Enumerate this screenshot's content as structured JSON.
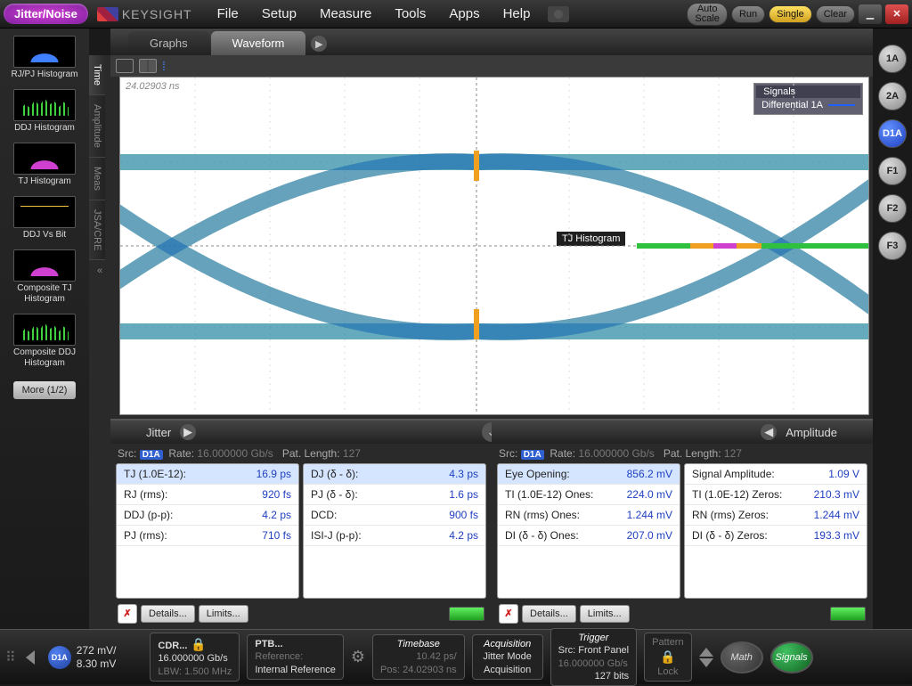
{
  "menubar": {
    "badge": "Jitter/Noise",
    "brand": "KEYSIGHT",
    "items": [
      "File",
      "Setup",
      "Measure",
      "Tools",
      "Apps",
      "Help"
    ],
    "buttons": {
      "auto": "Auto\nScale",
      "run": "Run",
      "single": "Single",
      "clear": "Clear"
    }
  },
  "left_thumbs": [
    {
      "label": "RJ/PJ Histogram",
      "color": "#4080ff",
      "kind": "gauss"
    },
    {
      "label": "DDJ Histogram",
      "color": "#40d040",
      "kind": "bars"
    },
    {
      "label": "TJ Histogram",
      "color": "#d040d0",
      "kind": "gauss"
    },
    {
      "label": "DDJ Vs Bit",
      "color": "#f0c040",
      "kind": "line"
    },
    {
      "label": "Composite TJ Histogram",
      "color": "#d040d0",
      "kind": "gauss"
    },
    {
      "label": "Composite DDJ Histogram",
      "color": "#40d0d0",
      "kind": "bars"
    }
  ],
  "more_btn": "More (1/2)",
  "vtabs": [
    "Time",
    "Amplitude",
    "Meas",
    "JSA/CRE"
  ],
  "vtab_active": 0,
  "main_tabs": [
    "Graphs",
    "Waveform"
  ],
  "main_tab_active": 1,
  "plot": {
    "timestamp": "24.02903 ns",
    "legend_title": "Signals",
    "legend_signal": "Differential 1A",
    "tj_label": "TJ Histogram"
  },
  "results": {
    "left": {
      "title": "Jitter",
      "src_label": "Src:",
      "src_chip": "D1A",
      "rate_label": "Rate:",
      "rate_value": "16.000000 Gb/s",
      "pat_label": "Pat. Length:",
      "pat_value": "127",
      "col1": [
        {
          "k": "TJ (1.0E-12):",
          "v": "16.9 ps",
          "hl": true
        },
        {
          "k": "RJ (rms):",
          "v": "920 fs"
        },
        {
          "k": "DDJ (p-p):",
          "v": "4.2 ps"
        },
        {
          "k": "PJ (rms):",
          "v": "710 fs"
        }
      ],
      "col2": [
        {
          "k": "DJ (δ - δ):",
          "v": "4.3 ps",
          "hl": true
        },
        {
          "k": "PJ (δ - δ):",
          "v": "1.6 ps"
        },
        {
          "k": "DCD:",
          "v": "900 fs"
        },
        {
          "k": "ISI-J (p-p):",
          "v": "4.2 ps"
        }
      ]
    },
    "right": {
      "title": "Amplitude",
      "src_label": "Src:",
      "src_chip": "D1A",
      "rate_label": "Rate:",
      "rate_value": "16.000000 Gb/s",
      "pat_label": "Pat. Length:",
      "pat_value": "127",
      "col1": [
        {
          "k": "Eye Opening:",
          "v": "856.2 mV",
          "hl": true
        },
        {
          "k": "TI (1.0E-12) Ones:",
          "v": "224.0 mV"
        },
        {
          "k": "RN (rms) Ones:",
          "v": "1.244 mV"
        },
        {
          "k": "DI (δ - δ) Ones:",
          "v": "207.0 mV"
        }
      ],
      "col2": [
        {
          "k": "Signal Amplitude:",
          "v": "1.09 V"
        },
        {
          "k": "TI (1.0E-12) Zeros:",
          "v": "210.3 mV"
        },
        {
          "k": "RN (rms) Zeros:",
          "v": "1.244 mV"
        },
        {
          "k": "DI (δ - δ) Zeros:",
          "v": "193.3 mV"
        }
      ]
    },
    "buttons": {
      "details": "Details...",
      "limits": "Limits..."
    }
  },
  "right_channels": [
    "1A",
    "2A",
    "D1A",
    "F1",
    "F2",
    "F3"
  ],
  "statusbar": {
    "chan": {
      "chip": "D1A",
      "line1": "272 mV/",
      "line2": "8.30 mV"
    },
    "cdr": {
      "title": "CDR...",
      "l1": "16.000000 Gb/s",
      "l2": "LBW: 1.500 MHz"
    },
    "ptb": {
      "title": "PTB...",
      "l1": "Reference:",
      "l2": "Internal Reference"
    },
    "timebase": {
      "title": "Timebase",
      "l1": "10.42 ps/",
      "l2": "Pos: 24.02903 ns"
    },
    "acquisition": {
      "title": "Acquisition",
      "l1": "Jitter Mode",
      "l2": "Acquisition"
    },
    "trigger": {
      "title": "Trigger",
      "l1": "Src: Front Panel",
      "l2": "16.000000 Gb/s",
      "l3": "127 bits"
    },
    "pattern": {
      "title": "Pattern",
      "sub": "Lock"
    },
    "math": "Math",
    "signals": "Signals"
  }
}
